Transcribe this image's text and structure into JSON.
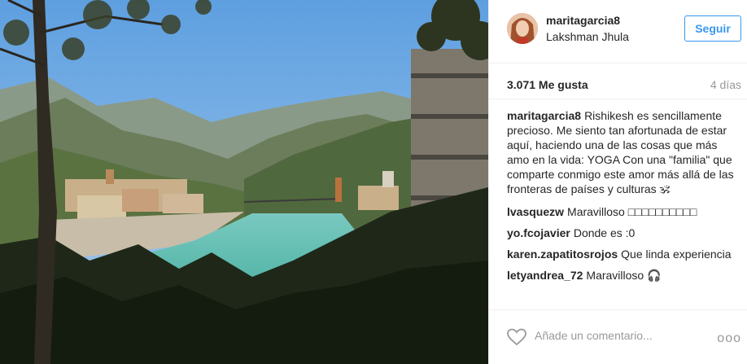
{
  "post": {
    "user": {
      "username": "maritagarcia8",
      "location": "Lakshman Jhula",
      "follow_label": "Seguir"
    },
    "likes": "3.071 Me gusta",
    "time": "4 días",
    "caption": {
      "user": "maritagarcia8",
      "text": "Rishikesh es sencillamente precioso. Me siento tan afortunada de estar aquí, haciendo una de las cosas que más amo en la vida: YOGA Con una \"familia\" que comparte conmigo este amor más allá de las fronteras de países y culturas 🕉"
    },
    "comments": [
      {
        "user": "lvasquezw",
        "text": "Maravilloso □□□□□□□□□□"
      },
      {
        "user": "yo.fcojavier",
        "text": "Donde es :0"
      },
      {
        "user": "karen.zapatitosrojos",
        "text": "Que linda experiencia"
      },
      {
        "user": "letyandrea_72",
        "text": "Maravilloso 🎧"
      }
    ],
    "add_comment_placeholder": "Añade un comentario...",
    "more_label": "ooo"
  },
  "icons": {
    "heart": "heart-icon",
    "more": "more-options-icon"
  },
  "colors": {
    "accent": "#3897f0",
    "text": "#262626",
    "muted": "#999999",
    "divider": "#efefef"
  }
}
